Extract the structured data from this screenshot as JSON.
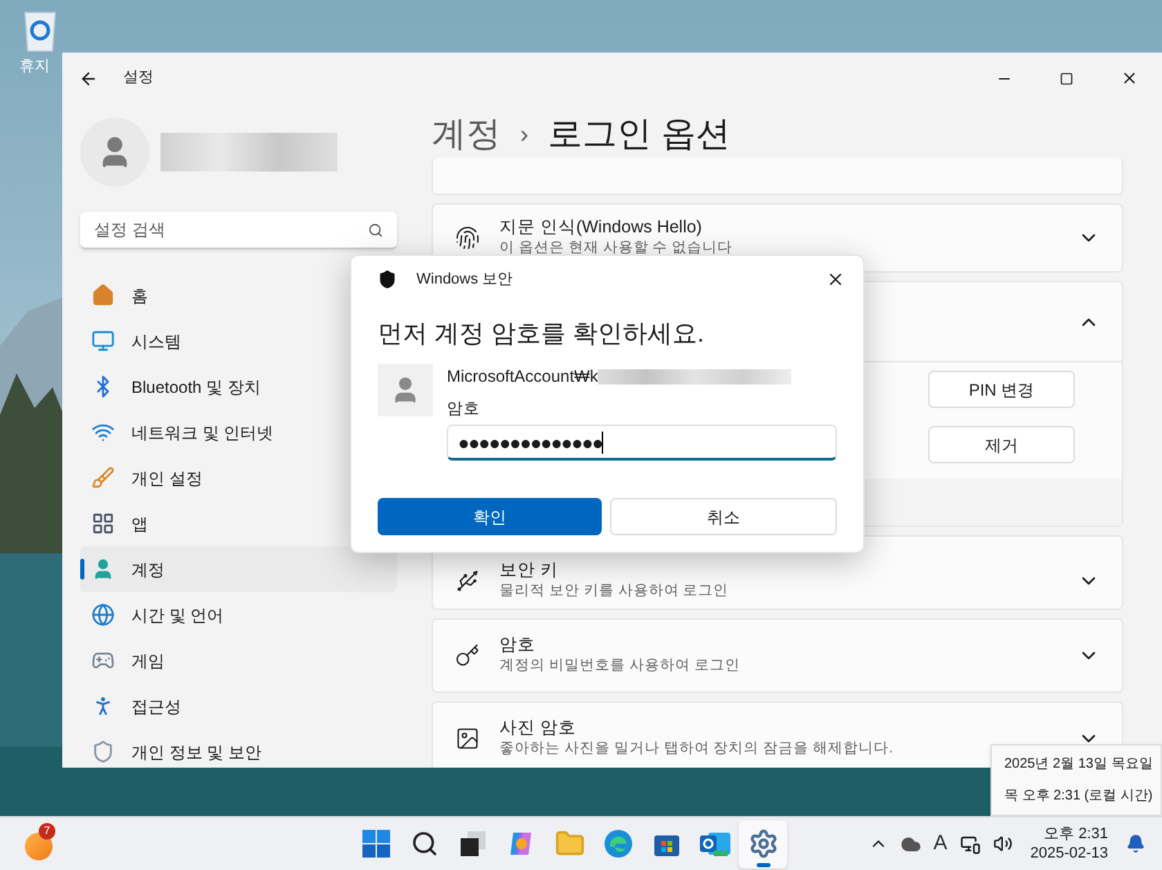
{
  "desktop": {
    "icons": [
      {
        "label": "휴지"
      }
    ]
  },
  "window": {
    "title": "설정"
  },
  "search": {
    "placeholder": "설정 검색"
  },
  "nav": [
    {
      "kind": "home",
      "label": "홈",
      "selected": false
    },
    {
      "kind": "system",
      "label": "시스템",
      "selected": false
    },
    {
      "kind": "bluetooth",
      "label": "Bluetooth 및 장치",
      "selected": false
    },
    {
      "kind": "network",
      "label": "네트워크 및 인터넷",
      "selected": false
    },
    {
      "kind": "personalize",
      "label": "개인 설정",
      "selected": false
    },
    {
      "kind": "apps",
      "label": "앱",
      "selected": false
    },
    {
      "kind": "accounts",
      "label": "계정",
      "selected": true
    },
    {
      "kind": "time",
      "label": "시간 및 언어",
      "selected": false
    },
    {
      "kind": "gaming",
      "label": "게임",
      "selected": false
    },
    {
      "kind": "accessibility",
      "label": "접근성",
      "selected": false
    },
    {
      "kind": "privacy",
      "label": "개인 정보 및 보안",
      "selected": false
    }
  ],
  "page": {
    "breadcrumb": [
      "계정",
      "로그인 옵션"
    ],
    "separator": "›"
  },
  "cards": [
    {
      "kind": "fingerprint",
      "title": "지문 인식(Windows Hello)",
      "subtitle": "이 옵션은 현재 사용할 수 없습니다",
      "expanded": false
    },
    {
      "kind": "pin",
      "expanded": true,
      "buttons": [
        "PIN 변경",
        "제거"
      ]
    },
    {
      "kind": "key",
      "title": "보안 키",
      "subtitle": "물리적 보안 키를 사용하여 로그인",
      "expanded": false
    },
    {
      "kind": "password",
      "title": "암호",
      "subtitle": "계정의 비밀번호를 사용하여 로그인",
      "expanded": false
    },
    {
      "title": "사진 암호",
      "subtitle": "좋아하는 사진을 밀거나 탭하여 장치의 잠금을 해제합니다.",
      "expanded": false
    }
  ],
  "dialog": {
    "title": "Windows 보안",
    "heading": "먼저 계정 암호를 확인하세요.",
    "account": "MicrosoftAccount₩k",
    "field_label": "암호",
    "password": {
      "value": "●●●●●●●●●●●●●●"
    },
    "buttons": [
      {
        "label": "확인",
        "primary": true
      },
      {
        "label": "취소",
        "primary": false
      }
    ]
  },
  "tooltip": {
    "lines": [
      "2025년 2월 13일 목요일",
      "목 오후 2:31 (로컬 시간)"
    ]
  },
  "taskbar": {
    "weather_badge": "7",
    "apps": [
      {
        "kind": "start",
        "selected": false
      },
      {
        "kind": "search",
        "selected": false
      },
      {
        "kind": "taskview",
        "selected": false
      },
      {
        "kind": "copilot",
        "selected": false
      },
      {
        "kind": "explorer",
        "selected": false
      },
      {
        "kind": "edge",
        "selected": false
      },
      {
        "kind": "store",
        "selected": false
      },
      {
        "kind": "outlook",
        "selected": false
      },
      {
        "kind": "settings",
        "selected": true
      }
    ],
    "tray": {
      "ime": "A",
      "time": "오후 2:31",
      "date": "2025-02-13"
    }
  }
}
